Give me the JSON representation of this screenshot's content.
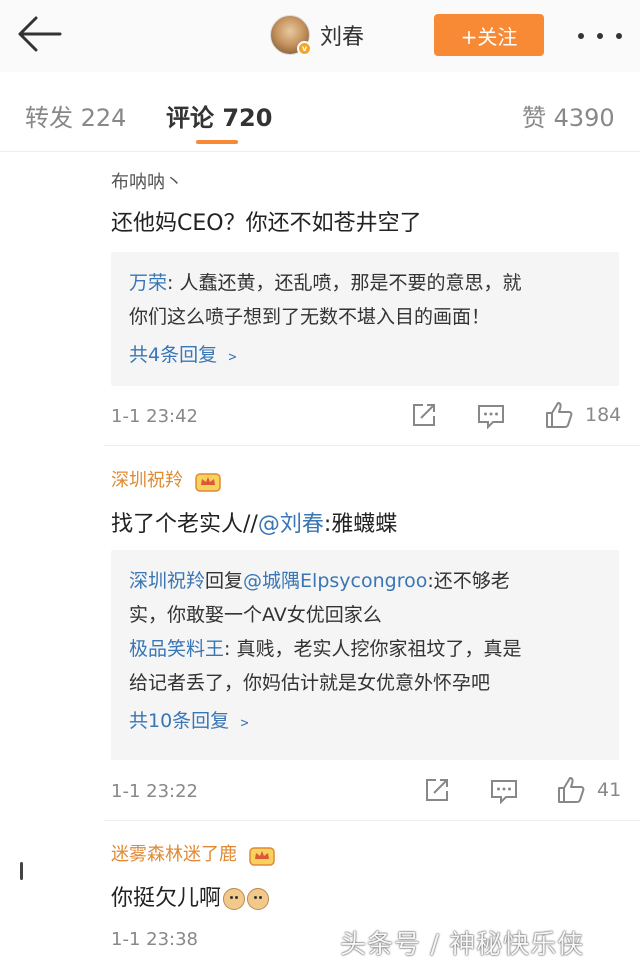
{
  "header": {
    "username": "刘春",
    "follow_label": "+关注"
  },
  "tabs": {
    "repost": "转发 224",
    "comments": "评论 720",
    "likes": "赞 4390"
  },
  "comments": [
    {
      "author": "布呐呐丶",
      "text": "还他妈CEO？你还不如苍井空了",
      "replies": [
        {
          "name": "万荣",
          "text": ": 人蠢还黄，还乱喷，那是不要的意思，就",
          "cont": "你们这么喷子想到了无数不堪入目的画面！"
        }
      ],
      "more_replies": "共4条回复 ﹥",
      "time": "1-1 23:42",
      "likes": "184"
    },
    {
      "author": "深圳祝羚",
      "text_before": "找了个老实人//",
      "mention": "@刘春",
      "text_after": ":雅蠛蝶",
      "reply1_name": "深圳祝羚",
      "reply1_mid": "回复",
      "reply1_mention": "@城隅Elpsycongroo",
      "reply1_text": ":还不够老",
      "reply1_cont": "实，你敢娶一个AV女优回家么",
      "reply2_name": "极品笑料王",
      "reply2_text": ": 真贱，老实人挖你家祖坟了，真是",
      "reply2_cont": "给记者丢了，你妈估计就是女优意外怀孕吧",
      "more_replies": "共10条回复 ﹥",
      "time": "1-1 23:22",
      "likes": "41"
    },
    {
      "author": "迷雾森林迷了鹿",
      "text": "你挺欠儿啊",
      "time": "1-1 23:38"
    }
  ],
  "watermark": "头条号 / 神秘快乐侠"
}
